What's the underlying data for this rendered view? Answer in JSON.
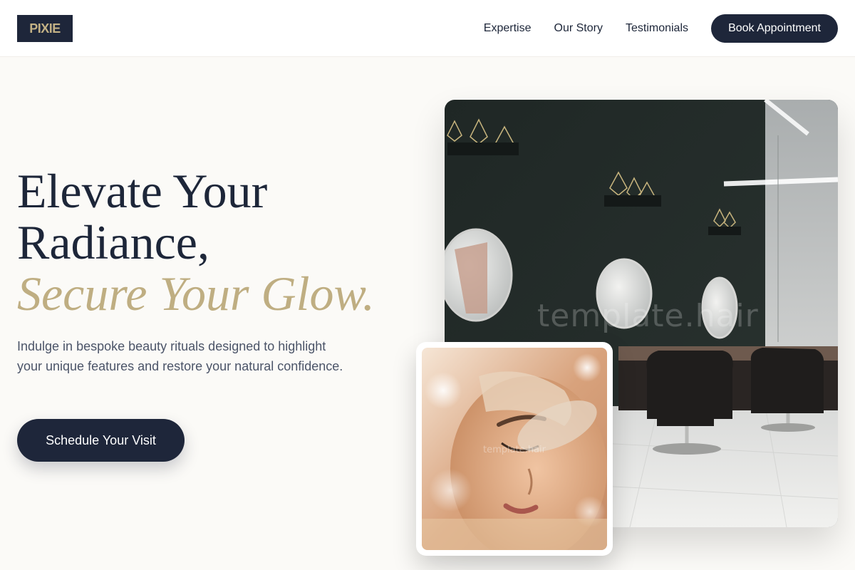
{
  "brand": {
    "logo_text": "PIXIE"
  },
  "nav": {
    "links": [
      "Expertise",
      "Our Story",
      "Testimonials"
    ],
    "cta_label": "Book Appointment"
  },
  "hero": {
    "title_line1": "Elevate Your",
    "title_line2": "Radiance,",
    "title_accent": "Secure Your Glow.",
    "subtitle": "Indulge in bespoke beauty rituals designed to highlight your unique features and restore your natural confidence.",
    "cta_label": "Schedule Your Visit"
  },
  "media": {
    "salon_watermark": "template.hair",
    "face_watermark": "template.hair"
  },
  "colors": {
    "navy": "#1e263a",
    "gold": "#bfae82",
    "background": "#fbfaf7"
  }
}
